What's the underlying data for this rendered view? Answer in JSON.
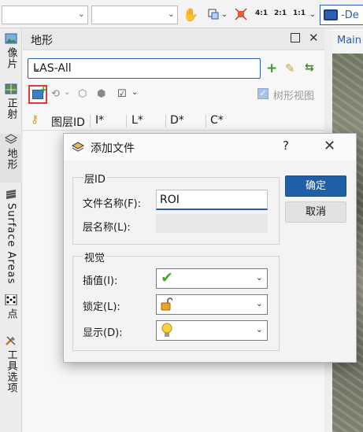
{
  "toolbar": {
    "zoom_4_1": "4:1",
    "zoom_2_1": "2:1",
    "zoom_1_1": "1:1",
    "view_selector": "-De"
  },
  "side_tabs": [
    "像片",
    "正射",
    "地形",
    "Surface Areas",
    "点",
    "工具选项"
  ],
  "panel": {
    "title": "地形",
    "layer_set": "LAS-All",
    "tree_view_label": "树形视图",
    "tree_view_checked": true,
    "columns": [
      "图层ID",
      "I*",
      "L*",
      "D*",
      "C*"
    ]
  },
  "right_tab": {
    "label": "Main"
  },
  "dialog": {
    "title": "添加文件",
    "help": "?",
    "group_layer_title": "层ID",
    "file_name_label": "文件名称(F):",
    "file_name_value": "ROI",
    "layer_name_label": "层名称(L):",
    "layer_name_value": "",
    "group_view_title": "视觉",
    "interpolate_label": "插值(I):",
    "lock_label": "锁定(L):",
    "display_label": "显示(D):",
    "ok": "确定",
    "cancel": "取消"
  }
}
